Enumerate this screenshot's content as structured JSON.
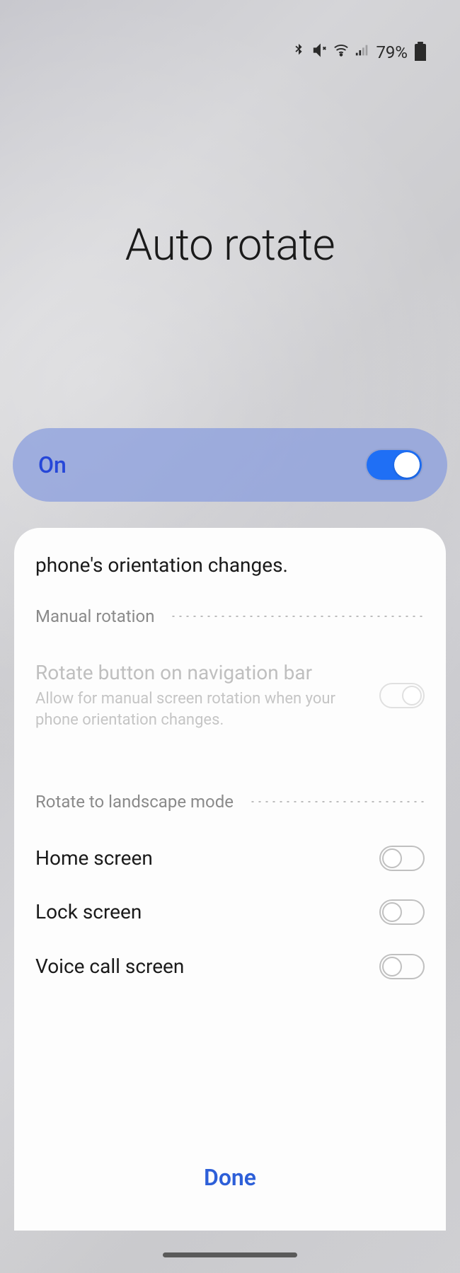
{
  "status_bar": {
    "battery_pct": "79%"
  },
  "title": "Auto rotate",
  "main_toggle": {
    "label": "On",
    "on": true
  },
  "panel": {
    "intro": "phone's orientation changes.",
    "sections": [
      {
        "label": "Manual rotation",
        "items": [
          {
            "title": "Rotate button on navigation bar",
            "desc": "Allow for manual screen rotation when your phone orientation changes.",
            "on": false,
            "disabled": true
          }
        ]
      },
      {
        "label": "Rotate to landscape mode",
        "items": [
          {
            "title": "Home screen",
            "on": false,
            "disabled": false
          },
          {
            "title": "Lock screen",
            "on": false,
            "disabled": false
          },
          {
            "title": "Voice call screen",
            "on": false,
            "disabled": false
          }
        ]
      }
    ]
  },
  "done_label": "Done"
}
